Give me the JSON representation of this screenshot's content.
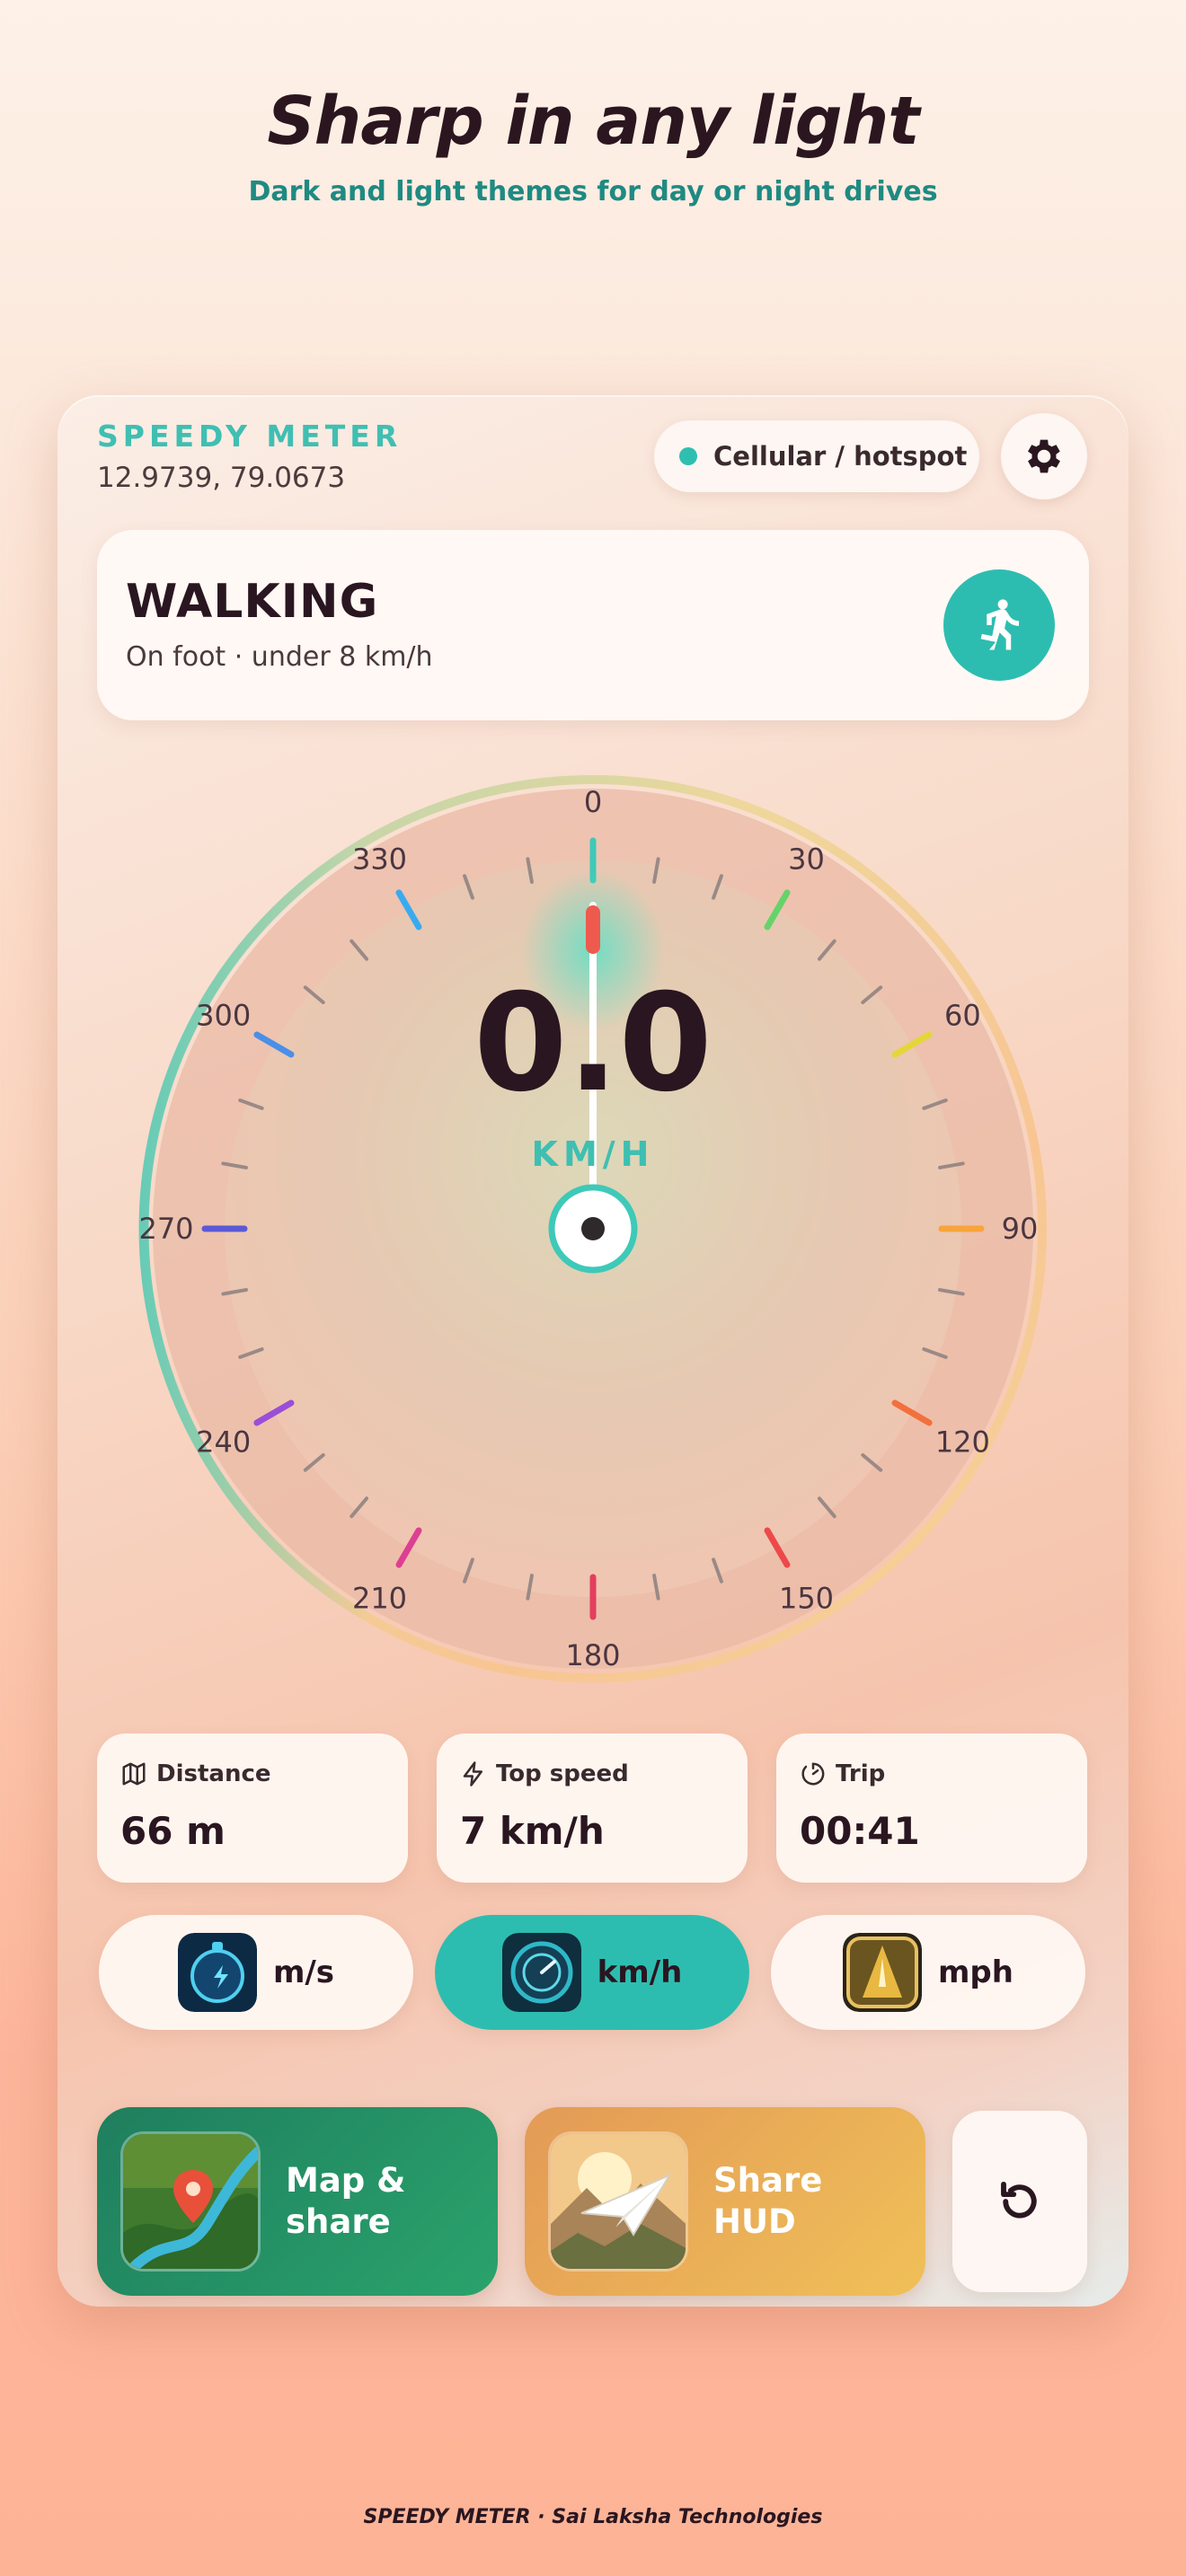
{
  "promo": {
    "headline": "Sharp in any light",
    "subheadline": "Dark and light themes for day or night drives"
  },
  "header": {
    "brand": "SPEEDY METER",
    "coordinates": "12.9739, 79.0673",
    "connection_label": "Cellular / hotspot",
    "connection_color": "#2fbfb0"
  },
  "mode": {
    "title": "WALKING",
    "subtitle": "On foot · under 8 km/h",
    "icon": "walking-person-icon",
    "accent": "#2dbdb0"
  },
  "gauge": {
    "speed": "0.0",
    "unit": "KM/H",
    "heading_degrees": 0,
    "ticks": [
      {
        "label": "0",
        "angle": 0,
        "color": "#3ec9b8"
      },
      {
        "label": "30",
        "angle": 30,
        "color": "#66d36a"
      },
      {
        "label": "60",
        "angle": 60,
        "color": "#e4d63a"
      },
      {
        "label": "90",
        "angle": 90,
        "color": "#f8a43a"
      },
      {
        "label": "120",
        "angle": 120,
        "color": "#f2703e"
      },
      {
        "label": "150",
        "angle": 150,
        "color": "#ec4a4a"
      },
      {
        "label": "180",
        "angle": 180,
        "color": "#e33e5e"
      },
      {
        "label": "210",
        "angle": 210,
        "color": "#dd3f93"
      },
      {
        "label": "240",
        "angle": 240,
        "color": "#9a4fd6"
      },
      {
        "label": "270",
        "angle": 270,
        "color": "#5a5ad8"
      },
      {
        "label": "300",
        "angle": 300,
        "color": "#4a8fe8"
      },
      {
        "label": "330",
        "angle": 330,
        "color": "#3aaaf0"
      }
    ]
  },
  "stats": [
    {
      "label": "Distance",
      "value": "66 m",
      "icon": "map-icon"
    },
    {
      "label": "Top speed",
      "value": "7 km/h",
      "icon": "lightning-icon"
    },
    {
      "label": "Trip",
      "value": "00:41",
      "icon": "timer-icon"
    }
  ],
  "units": [
    {
      "label": "m/s",
      "icon": "compass-icon",
      "active": false
    },
    {
      "label": "km/h",
      "icon": "gauge-icon",
      "active": true
    },
    {
      "label": "mph",
      "icon": "road-icon",
      "active": false
    }
  ],
  "actions": {
    "map_share": "Map & share",
    "share_hud": "Share HUD",
    "map_color": "#2a9d6a",
    "hud_color": "#e8a14e",
    "reset_icon": "reset-icon"
  },
  "footer": {
    "text": "SPEEDY METER  ·  Sai Laksha Technologies"
  }
}
